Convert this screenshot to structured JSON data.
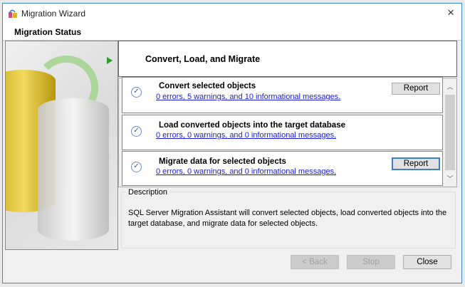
{
  "window": {
    "title": "Migration Wizard",
    "close_icon": "×"
  },
  "header": {
    "title": "Migration Status"
  },
  "step_header": {
    "title": "Convert, Load, and Migrate"
  },
  "steps": [
    {
      "name": "Convert selected objects",
      "summary": "0 errors, 5 warnings, and 10 informational messages.",
      "button": "Report"
    },
    {
      "name": "Load converted objects into the target database",
      "summary": "0 errors, 0 warnings, and 0 informational messages."
    },
    {
      "name": "Migrate data for selected objects",
      "summary": "0 errors, 0 warnings, and 0 informational messages.",
      "button": "Report"
    }
  ],
  "description": {
    "label": "Description",
    "text": "SQL Server Migration Assistant will convert selected objects, load converted objects into the target database, and migrate data for selected objects."
  },
  "footer": {
    "back": "< Back",
    "stop": "Stop",
    "close": "Close"
  }
}
